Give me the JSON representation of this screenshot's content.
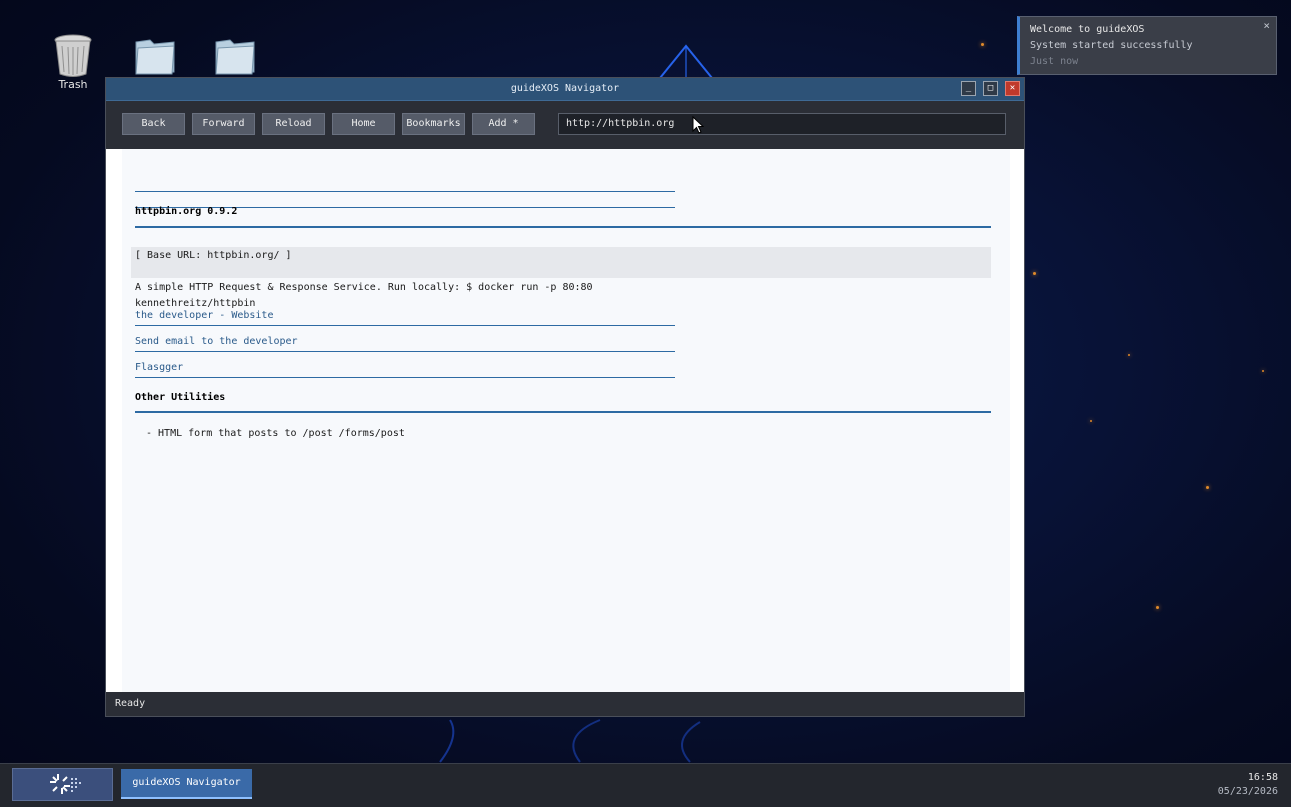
{
  "desktop": {
    "icons": [
      {
        "label": "Trash",
        "icon": "trash-icon"
      },
      {
        "label": "",
        "icon": "folder-icon"
      },
      {
        "label": "",
        "icon": "folder-icon"
      }
    ]
  },
  "notification": {
    "title": "Welcome to guideXOS",
    "message": "System started successfully",
    "time": "Just now",
    "close": "×"
  },
  "window": {
    "title": "guideXOS Navigator",
    "controls": {
      "minimize": "_",
      "maximize": "□",
      "close": "✕"
    },
    "toolbar": {
      "back": "Back",
      "forward": "Forward",
      "reload": "Reload",
      "home": "Home",
      "bookmarks": "Bookmarks",
      "add": "Add *"
    },
    "url": "http://httpbin.org",
    "status": "Ready"
  },
  "page": {
    "heading": "httpbin.org 0.9.2",
    "base_url": "[ Base URL: httpbin.org/ ]",
    "description_line1": "A simple HTTP Request & Response Service. Run locally: $ docker run -p 80:80",
    "description_line2": "kennethreitz/httpbin",
    "links": [
      "the developer - Website",
      "Send email to the developer",
      "Flasgger"
    ],
    "section_heading": "Other Utilities",
    "list_items": [
      "-  HTML form that posts to /post /forms/post"
    ]
  },
  "taskbar": {
    "task": "guideXOS Navigator",
    "time": "16:58",
    "date": "05/23/2026"
  },
  "colors": {
    "accent": "#2d6aa3",
    "titlebar": "#2d5277",
    "close_button": "#c0392b",
    "taskbar_active": "#3a6aa8"
  }
}
